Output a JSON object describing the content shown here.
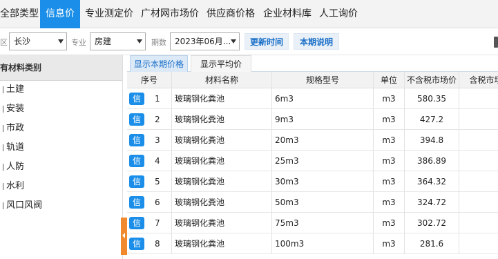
{
  "topnav": {
    "tabs": [
      {
        "label": "全部类型"
      },
      {
        "label": "信息价"
      },
      {
        "label": "专业测定价"
      },
      {
        "label": "广材网市场价"
      },
      {
        "label": "供应商价格"
      },
      {
        "label": "企业材料库"
      },
      {
        "label": "人工询价"
      }
    ]
  },
  "filters": {
    "region_label": "区",
    "region_value": "长沙",
    "major_label": "专业",
    "major_value": "房建",
    "period_label": "期数",
    "period_value": "2023年06月...",
    "update_button": "更新时间",
    "notes_button": "本期说明"
  },
  "left_panel": {
    "header": "有材料类别",
    "items": [
      {
        "label": "土建"
      },
      {
        "label": "安装"
      },
      {
        "label": "市政"
      },
      {
        "label": "轨道"
      },
      {
        "label": "人防"
      },
      {
        "label": "水利"
      },
      {
        "label": "风口风阀"
      }
    ]
  },
  "subtabs": [
    {
      "label": "显示本期价格"
    },
    {
      "label": "显示平均价"
    }
  ],
  "table": {
    "headers": {
      "seq": "序号",
      "name": "材料名称",
      "spec": "规格型号",
      "unit": "单位",
      "price_ex_tax": "不含税市场价",
      "price_inc_tax": "含税市场价"
    },
    "badge_text": "信",
    "rows": [
      {
        "seq": "1",
        "name": "玻璃钢化粪池",
        "spec": "6m3",
        "unit": "m3",
        "price": "580.35",
        "tax_price": ""
      },
      {
        "seq": "2",
        "name": "玻璃钢化粪池",
        "spec": "9m3",
        "unit": "m3",
        "price": "427.2",
        "tax_price": ""
      },
      {
        "seq": "3",
        "name": "玻璃钢化粪池",
        "spec": "20m3",
        "unit": "m3",
        "price": "394.8",
        "tax_price": ""
      },
      {
        "seq": "4",
        "name": "玻璃钢化粪池",
        "spec": "25m3",
        "unit": "m3",
        "price": "386.89",
        "tax_price": ""
      },
      {
        "seq": "5",
        "name": "玻璃钢化粪池",
        "spec": "30m3",
        "unit": "m3",
        "price": "364.32",
        "tax_price": ""
      },
      {
        "seq": "6",
        "name": "玻璃钢化粪池",
        "spec": "50m3",
        "unit": "m3",
        "price": "324.72",
        "tax_price": ""
      },
      {
        "seq": "7",
        "name": "玻璃钢化粪池",
        "spec": "75m3",
        "unit": "m3",
        "price": "302.72",
        "tax_price": ""
      },
      {
        "seq": "8",
        "name": "玻璃钢化粪池",
        "spec": "100m3",
        "unit": "m3",
        "price": "281.6",
        "tax_price": ""
      }
    ]
  }
}
